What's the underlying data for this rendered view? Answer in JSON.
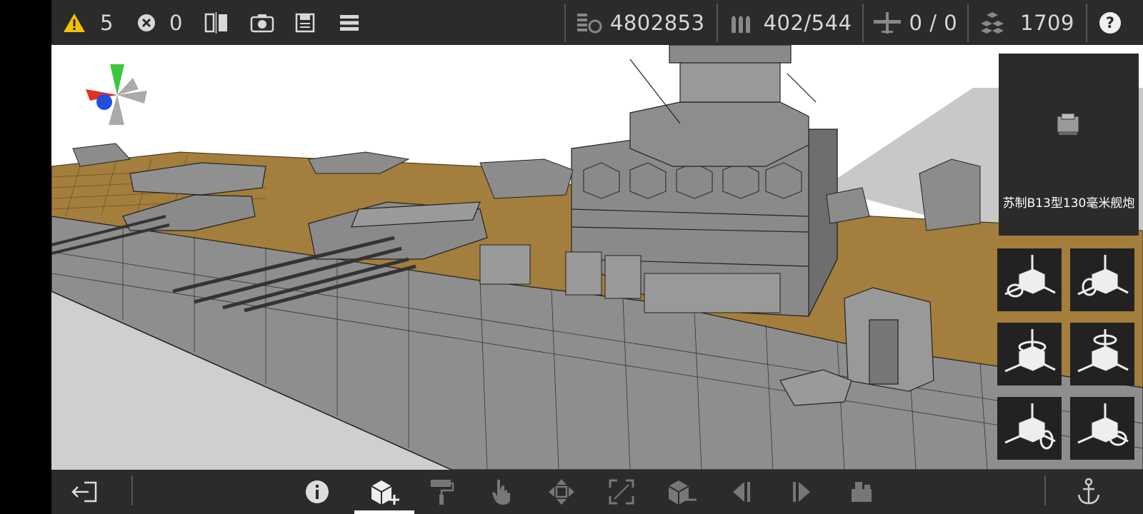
{
  "top_bar": {
    "warnings": {
      "icon": "warning-icon",
      "count": "5",
      "color": "#f2c200"
    },
    "errors": {
      "icon": "error-icon",
      "count": "0"
    },
    "tools": [
      "mirror-icon",
      "camera-icon",
      "save-icon",
      "menu-icon"
    ],
    "money": {
      "icon": "money-icon",
      "value": "4802853"
    },
    "ammo": {
      "icon": "ammo-icon",
      "value": "402/544"
    },
    "aircraft": {
      "icon": "aircraft-icon",
      "value": "0 / 0"
    },
    "parts": {
      "icon": "parts-icon",
      "value": "1709"
    },
    "help": {
      "icon": "help-icon"
    }
  },
  "preview": {
    "part_name": "苏制B13型130毫米舰炮"
  },
  "rotate_buttons": [
    "rotate-x-plus-icon",
    "rotate-x-minus-icon",
    "rotate-y-plus-icon",
    "rotate-y-minus-icon",
    "rotate-z-plus-icon",
    "rotate-z-minus-icon"
  ],
  "bottom_bar": {
    "buttons": [
      "exit-icon",
      "info-icon",
      "add-part-icon",
      "paint-icon",
      "select-icon",
      "move-icon",
      "scale-icon",
      "remove-part-icon",
      "prev-icon",
      "next-icon",
      "stack-icon",
      "anchor-icon"
    ],
    "active": "add-part-icon"
  },
  "colors": {
    "bar_bg": "#2b2b2b",
    "deck": "#a37e3c",
    "hull": "#8e8e8e",
    "warning": "#f2c200"
  }
}
